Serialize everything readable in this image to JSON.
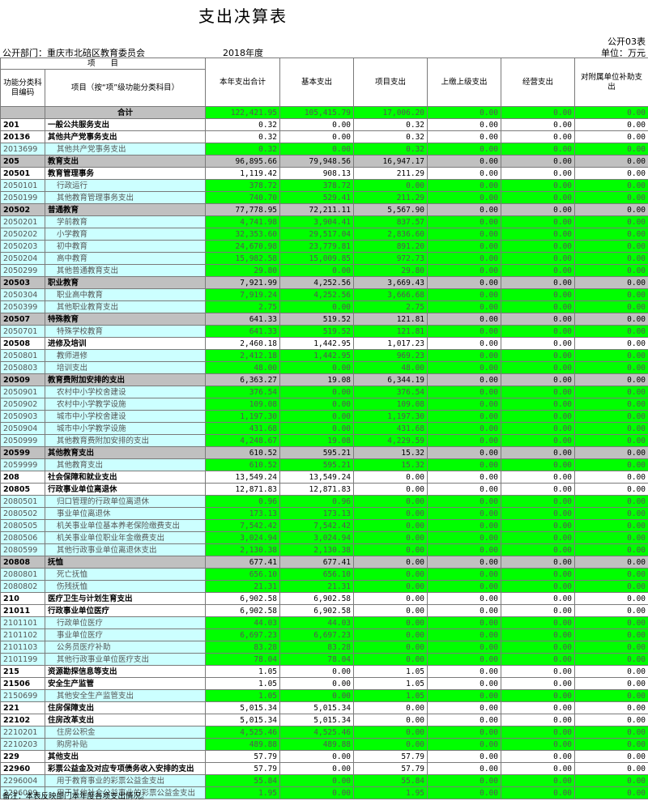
{
  "title": "支出决算表",
  "form_no": "公开03表",
  "dept": "公开部门：重庆市北碚区教育委员会",
  "year": "2018年度",
  "unit": "单位：万元",
  "headers": {
    "project_group": "项　　目",
    "code": "功能分类科目编码",
    "name": "项目（按“项”级功能分类科目）",
    "total": "本年支出合计",
    "basic": "基本支出",
    "project": "项目支出",
    "upper": "上缴上级支出",
    "business": "经营支出",
    "subsidy": "对附属单位补助支出"
  },
  "rows": [
    {
      "level": "total",
      "code": "",
      "name": "合计",
      "v": [
        "122,421.95",
        "105,415.79",
        "17,006.20",
        "0.00",
        "0.00",
        "0.00"
      ]
    },
    {
      "level": "l1",
      "code": "201",
      "name": "一般公共服务支出",
      "v": [
        "0.32",
        "0.00",
        "0.32",
        "0.00",
        "0.00",
        "0.00"
      ]
    },
    {
      "level": "l2",
      "code": "20136",
      "name": "其他共产党事务支出",
      "v": [
        "0.32",
        "0.00",
        "0.32",
        "0.00",
        "0.00",
        "0.00"
      ]
    },
    {
      "level": "l3",
      "code": "2013699",
      "name": "其他共产党事务支出",
      "v": [
        "0.32",
        "0.00",
        "0.32",
        "0.00",
        "0.00",
        "0.00"
      ]
    },
    {
      "level": "l0",
      "code": "205",
      "name": "教育支出",
      "v": [
        "96,895.66",
        "79,948.56",
        "16,947.17",
        "0.00",
        "0.00",
        "0.00"
      ]
    },
    {
      "level": "l2",
      "code": "20501",
      "name": "教育管理事务",
      "v": [
        "1,119.42",
        "908.13",
        "211.29",
        "0.00",
        "0.00",
        "0.00"
      ]
    },
    {
      "level": "l3",
      "code": "2050101",
      "name": "行政运行",
      "v": [
        "378.72",
        "378.72",
        "0.00",
        "0.00",
        "0.00",
        "0.00"
      ]
    },
    {
      "level": "l3",
      "code": "2050199",
      "name": "其他教育管理事务支出",
      "v": [
        "740.70",
        "529.41",
        "211.29",
        "0.00",
        "0.00",
        "0.00"
      ]
    },
    {
      "level": "l0",
      "code": "20502",
      "name": "普通教育",
      "v": [
        "77,778.95",
        "72,211.11",
        "5,567.90",
        "0.00",
        "0.00",
        "0.00"
      ]
    },
    {
      "level": "l3",
      "code": "2050201",
      "name": "学前教育",
      "v": [
        "4,741.98",
        "3,904.41",
        "837.57",
        "0.00",
        "0.00",
        "0.00"
      ]
    },
    {
      "level": "l3",
      "code": "2050202",
      "name": "小学教育",
      "v": [
        "32,353.60",
        "29,517.04",
        "2,836.60",
        "0.00",
        "0.00",
        "0.00"
      ]
    },
    {
      "level": "l3",
      "code": "2050203",
      "name": "初中教育",
      "v": [
        "24,670.98",
        "23,779.81",
        "891.20",
        "0.00",
        "0.00",
        "0.00"
      ]
    },
    {
      "level": "l3",
      "code": "2050204",
      "name": "高中教育",
      "v": [
        "15,982.58",
        "15,009.85",
        "972.73",
        "0.00",
        "0.00",
        "0.00"
      ]
    },
    {
      "level": "l3",
      "code": "2050299",
      "name": "其他普通教育支出",
      "v": [
        "29.80",
        "0.00",
        "29.80",
        "0.00",
        "0.00",
        "0.00"
      ]
    },
    {
      "level": "l0",
      "code": "20503",
      "name": "职业教育",
      "v": [
        "7,921.99",
        "4,252.56",
        "3,669.43",
        "0.00",
        "0.00",
        "0.00"
      ]
    },
    {
      "level": "l3",
      "code": "2050304",
      "name": "职业高中教育",
      "v": [
        "7,919.24",
        "4,252.56",
        "3,666.68",
        "0.00",
        "0.00",
        "0.00"
      ]
    },
    {
      "level": "l3",
      "code": "2050399",
      "name": "其他职业教育支出",
      "v": [
        "2.75",
        "0.00",
        "2.75",
        "0.00",
        "0.00",
        "0.00"
      ]
    },
    {
      "level": "l0",
      "code": "20507",
      "name": "特殊教育",
      "v": [
        "641.33",
        "519.52",
        "121.81",
        "0.00",
        "0.00",
        "0.00"
      ]
    },
    {
      "level": "l3",
      "code": "2050701",
      "name": "特殊学校教育",
      "v": [
        "641.33",
        "519.52",
        "121.81",
        "0.00",
        "0.00",
        "0.00"
      ]
    },
    {
      "level": "l2",
      "code": "20508",
      "name": "进修及培训",
      "v": [
        "2,460.18",
        "1,442.95",
        "1,017.23",
        "0.00",
        "0.00",
        "0.00"
      ]
    },
    {
      "level": "l3",
      "code": "2050801",
      "name": "教师进修",
      "v": [
        "2,412.18",
        "1,442.95",
        "969.23",
        "0.00",
        "0.00",
        "0.00"
      ]
    },
    {
      "level": "l3",
      "code": "2050803",
      "name": "培训支出",
      "v": [
        "48.00",
        "0.00",
        "48.00",
        "0.00",
        "0.00",
        "0.00"
      ]
    },
    {
      "level": "l0",
      "code": "20509",
      "name": "教育费附加安排的支出",
      "v": [
        "6,363.27",
        "19.08",
        "6,344.19",
        "0.00",
        "0.00",
        "0.00"
      ]
    },
    {
      "level": "l3",
      "code": "2050901",
      "name": "农村中小学校舍建设",
      "v": [
        "376.54",
        "0.00",
        "376.54",
        "0.00",
        "0.00",
        "0.00"
      ]
    },
    {
      "level": "l3",
      "code": "2050902",
      "name": "农村中小学教学设施",
      "v": [
        "109.08",
        "0.00",
        "109.08",
        "0.00",
        "0.00",
        "0.00"
      ]
    },
    {
      "level": "l3",
      "code": "2050903",
      "name": "城市中小学校舍建设",
      "v": [
        "1,197.30",
        "0.00",
        "1,197.30",
        "0.00",
        "0.00",
        "0.00"
      ]
    },
    {
      "level": "l3",
      "code": "2050904",
      "name": "城市中小学教学设施",
      "v": [
        "431.68",
        "0.00",
        "431.68",
        "0.00",
        "0.00",
        "0.00"
      ]
    },
    {
      "level": "l3",
      "code": "2050999",
      "name": "其他教育费附加安排的支出",
      "v": [
        "4,248.67",
        "19.08",
        "4,229.59",
        "0.00",
        "0.00",
        "0.00"
      ]
    },
    {
      "level": "l0",
      "code": "20599",
      "name": "其他教育支出",
      "v": [
        "610.52",
        "595.21",
        "15.32",
        "0.00",
        "0.00",
        "0.00"
      ]
    },
    {
      "level": "l3",
      "code": "2059999",
      "name": "其他教育支出",
      "v": [
        "610.52",
        "595.21",
        "15.32",
        "0.00",
        "0.00",
        "0.00"
      ]
    },
    {
      "level": "l1",
      "code": "208",
      "name": "社会保障和就业支出",
      "v": [
        "13,549.24",
        "13,549.24",
        "0.00",
        "0.00",
        "0.00",
        "0.00"
      ]
    },
    {
      "level": "l2",
      "code": "20805",
      "name": "行政事业单位离退休",
      "v": [
        "12,871.83",
        "12,871.83",
        "0.00",
        "0.00",
        "0.00",
        "0.00"
      ]
    },
    {
      "level": "l3",
      "code": "2080501",
      "name": "归口管理的行政单位离退休",
      "v": [
        "0.96",
        "0.96",
        "0.00",
        "0.00",
        "0.00",
        "0.00"
      ]
    },
    {
      "level": "l3",
      "code": "2080502",
      "name": "事业单位离退休",
      "v": [
        "173.13",
        "173.13",
        "0.00",
        "0.00",
        "0.00",
        "0.00"
      ]
    },
    {
      "level": "l3",
      "code": "2080505",
      "name": "机关事业单位基本养老保险缴费支出",
      "v": [
        "7,542.42",
        "7,542.42",
        "0.00",
        "0.00",
        "0.00",
        "0.00"
      ]
    },
    {
      "level": "l3",
      "code": "2080506",
      "name": "机关事业单位职业年金缴费支出",
      "v": [
        "3,024.94",
        "3,024.94",
        "0.00",
        "0.00",
        "0.00",
        "0.00"
      ]
    },
    {
      "level": "l3",
      "code": "2080599",
      "name": "其他行政事业单位离退休支出",
      "v": [
        "2,130.38",
        "2,130.38",
        "0.00",
        "0.00",
        "0.00",
        "0.00"
      ]
    },
    {
      "level": "l0",
      "code": "20808",
      "name": "抚恤",
      "v": [
        "677.41",
        "677.41",
        "0.00",
        "0.00",
        "0.00",
        "0.00"
      ]
    },
    {
      "level": "l3",
      "code": "2080801",
      "name": "死亡抚恤",
      "v": [
        "656.10",
        "656.10",
        "0.00",
        "0.00",
        "0.00",
        "0.00"
      ]
    },
    {
      "level": "l3",
      "code": "2080802",
      "name": "伤残抚恤",
      "v": [
        "21.31",
        "21.31",
        "0.00",
        "0.00",
        "0.00",
        "0.00"
      ]
    },
    {
      "level": "l1",
      "code": "210",
      "name": "医疗卫生与计划生育支出",
      "v": [
        "6,902.58",
        "6,902.58",
        "0.00",
        "0.00",
        "0.00",
        "0.00"
      ]
    },
    {
      "level": "l2",
      "code": "21011",
      "name": "行政事业单位医疗",
      "v": [
        "6,902.58",
        "6,902.58",
        "0.00",
        "0.00",
        "0.00",
        "0.00"
      ]
    },
    {
      "level": "l3",
      "code": "2101101",
      "name": "行政单位医疗",
      "v": [
        "44.03",
        "44.03",
        "0.00",
        "0.00",
        "0.00",
        "0.00"
      ]
    },
    {
      "level": "l3",
      "code": "2101102",
      "name": "事业单位医疗",
      "v": [
        "6,697.23",
        "6,697.23",
        "0.00",
        "0.00",
        "0.00",
        "0.00"
      ]
    },
    {
      "level": "l3",
      "code": "2101103",
      "name": "公务员医疗补助",
      "v": [
        "83.28",
        "83.28",
        "0.00",
        "0.00",
        "0.00",
        "0.00"
      ]
    },
    {
      "level": "l3",
      "code": "2101199",
      "name": "其他行政事业单位医疗支出",
      "v": [
        "78.04",
        "78.04",
        "0.00",
        "0.00",
        "0.00",
        "0.00"
      ]
    },
    {
      "level": "l1",
      "code": "215",
      "name": "资源勘探信息等支出",
      "v": [
        "1.05",
        "0.00",
        "1.05",
        "0.00",
        "0.00",
        "0.00"
      ]
    },
    {
      "level": "l2",
      "code": "21506",
      "name": "安全生产监管",
      "v": [
        "1.05",
        "0.00",
        "1.05",
        "0.00",
        "0.00",
        "0.00"
      ]
    },
    {
      "level": "l3",
      "code": "2150699",
      "name": "其他安全生产监管支出",
      "v": [
        "1.05",
        "0.00",
        "1.05",
        "0.00",
        "0.00",
        "0.00"
      ]
    },
    {
      "level": "l1",
      "code": "221",
      "name": "住房保障支出",
      "v": [
        "5,015.34",
        "5,015.34",
        "0.00",
        "0.00",
        "0.00",
        "0.00"
      ]
    },
    {
      "level": "l2",
      "code": "22102",
      "name": "住房改革支出",
      "v": [
        "5,015.34",
        "5,015.34",
        "0.00",
        "0.00",
        "0.00",
        "0.00"
      ]
    },
    {
      "level": "l3",
      "code": "2210201",
      "name": "住房公积金",
      "v": [
        "4,525.46",
        "4,525.46",
        "0.00",
        "0.00",
        "0.00",
        "0.00"
      ]
    },
    {
      "level": "l3",
      "code": "2210203",
      "name": "购房补贴",
      "v": [
        "489.88",
        "489.88",
        "0.00",
        "0.00",
        "0.00",
        "0.00"
      ]
    },
    {
      "level": "l1",
      "code": "229",
      "name": "其他支出",
      "v": [
        "57.79",
        "0.00",
        "57.79",
        "0.00",
        "0.00",
        "0.00"
      ]
    },
    {
      "level": "l2",
      "code": "22960",
      "name": "彩票公益金及对应专项债务收入安排的支出",
      "v": [
        "57.79",
        "0.00",
        "57.79",
        "0.00",
        "0.00",
        "0.00"
      ]
    },
    {
      "level": "l3",
      "code": "2296004",
      "name": "用于教育事业的彩票公益金支出",
      "v": [
        "55.84",
        "0.00",
        "55.84",
        "0.00",
        "0.00",
        "0.00"
      ]
    },
    {
      "level": "l3",
      "code": "2296099",
      "name": "用于其他社会公益事业的彩票公益金支出",
      "v": [
        "1.95",
        "0.00",
        "1.95",
        "0.00",
        "0.00",
        "0.00"
      ]
    }
  ],
  "note": "备注：本表反映部门本年度各项支出情况。",
  "colors": {
    "header_gray": "#c0c0c0",
    "cell_green": "#00ff00",
    "cell_cyan": "#ccffff"
  }
}
